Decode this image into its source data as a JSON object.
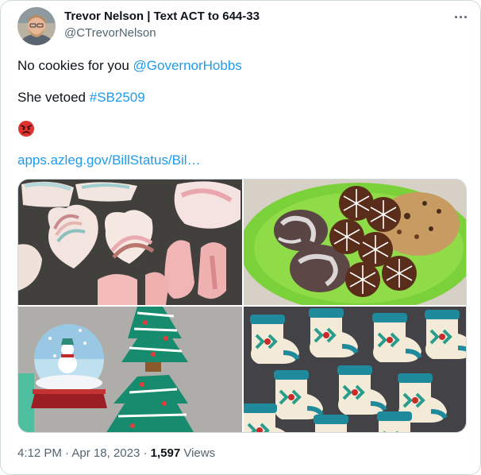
{
  "author": {
    "display_name": "Trevor Nelson | Text ACT to 644-33",
    "handle": "@CTrevorNelson",
    "avatar_icon": "person-avatar"
  },
  "tweet": {
    "line1_text": "No cookies for you ",
    "line1_mention": "@GovernorHobbs",
    "line2_text": "She vetoed ",
    "line2_hashtag": "#SB2509",
    "emoji": "angry-face",
    "link_text": "apps.azleg.gov/BillStatus/Bil…"
  },
  "media": {
    "images": [
      "heart-rainbow-cookies",
      "snowflake-and-crinkle-cookies",
      "snow-globe-and-tree-cookies",
      "christmas-stocking-cookies"
    ]
  },
  "meta": {
    "time": "4:12 PM",
    "separator": "·",
    "date": "Apr 18, 2023",
    "views_count": "1,597",
    "views_label": " Views"
  },
  "colors": {
    "link": "#1d9bf0",
    "secondary_text": "#536471",
    "border": "#cfd9de"
  }
}
